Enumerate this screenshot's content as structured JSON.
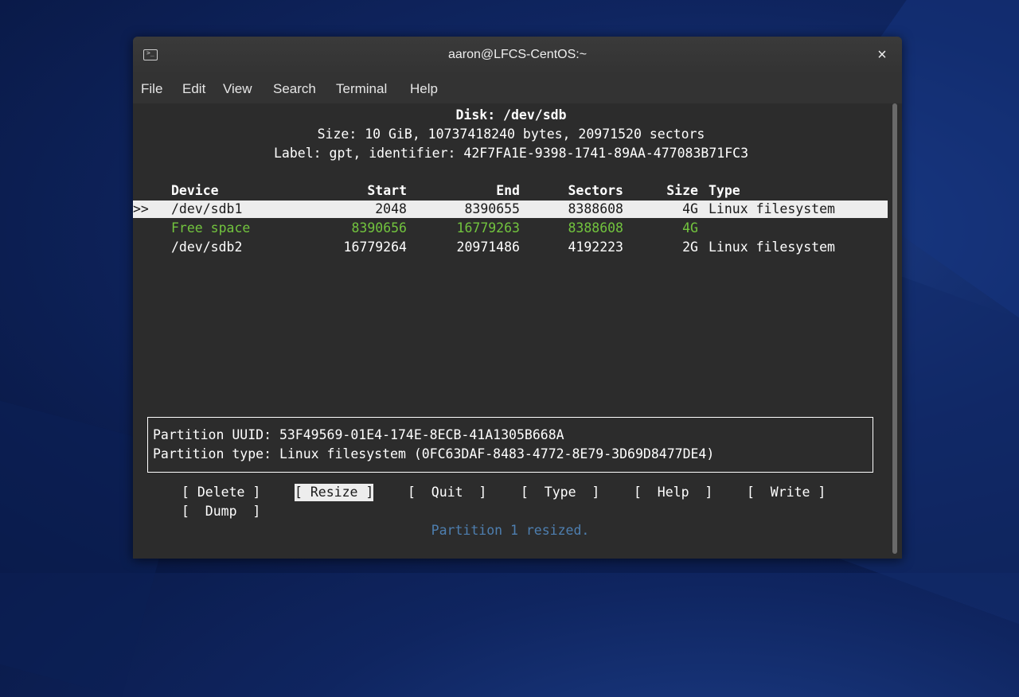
{
  "window": {
    "title": "aaron@LFCS-CentOS:~",
    "close_glyph": "×",
    "icon": "terminal-icon"
  },
  "menu": [
    "File",
    "Edit",
    "View",
    "Search",
    "Terminal",
    "Help"
  ],
  "disk": {
    "title": "Disk: /dev/sdb",
    "size_line": "Size: 10 GiB, 10737418240 bytes, 20971520 sectors",
    "label_line": "Label: gpt, identifier: 42F7FA1E-9398-1741-89AA-477083B71FC3"
  },
  "table": {
    "headers": {
      "device": "Device",
      "start": "Start",
      "end": "End",
      "sectors": "Sectors",
      "size": "Size",
      "type": "Type"
    },
    "selector": ">>",
    "rows": [
      {
        "device": "/dev/sdb1",
        "start": "2048",
        "end": "8390655",
        "sectors": "8388608",
        "size": "4G",
        "type": "Linux filesystem"
      },
      {
        "device": "Free space",
        "start": "8390656",
        "end": "16779263",
        "sectors": "8388608",
        "size": "4G",
        "type": ""
      },
      {
        "device": "/dev/sdb2",
        "start": "16779264",
        "end": "20971486",
        "sectors": "4192223",
        "size": "2G",
        "type": "Linux filesystem"
      }
    ]
  },
  "info": {
    "uuid_line": "Partition UUID: 53F49569-01E4-174E-8ECB-41A1305B668A",
    "type_line": "Partition type: Linux filesystem (0FC63DAF-8483-4772-8E79-3D69D8477DE4)"
  },
  "buttons": {
    "delete": "[ Delete ]",
    "resize": "[ Resize ]",
    "quit": "[  Quit  ]",
    "type": "[  Type  ]",
    "help": "[  Help  ]",
    "write": "[  Write ]",
    "dump": "[  Dump  ]"
  },
  "status": "Partition 1 resized.",
  "colors": {
    "free_space": "#72c43e",
    "status": "#4e7fb0",
    "selection": "#ededed",
    "terminal_bg": "#2c2c2c"
  }
}
